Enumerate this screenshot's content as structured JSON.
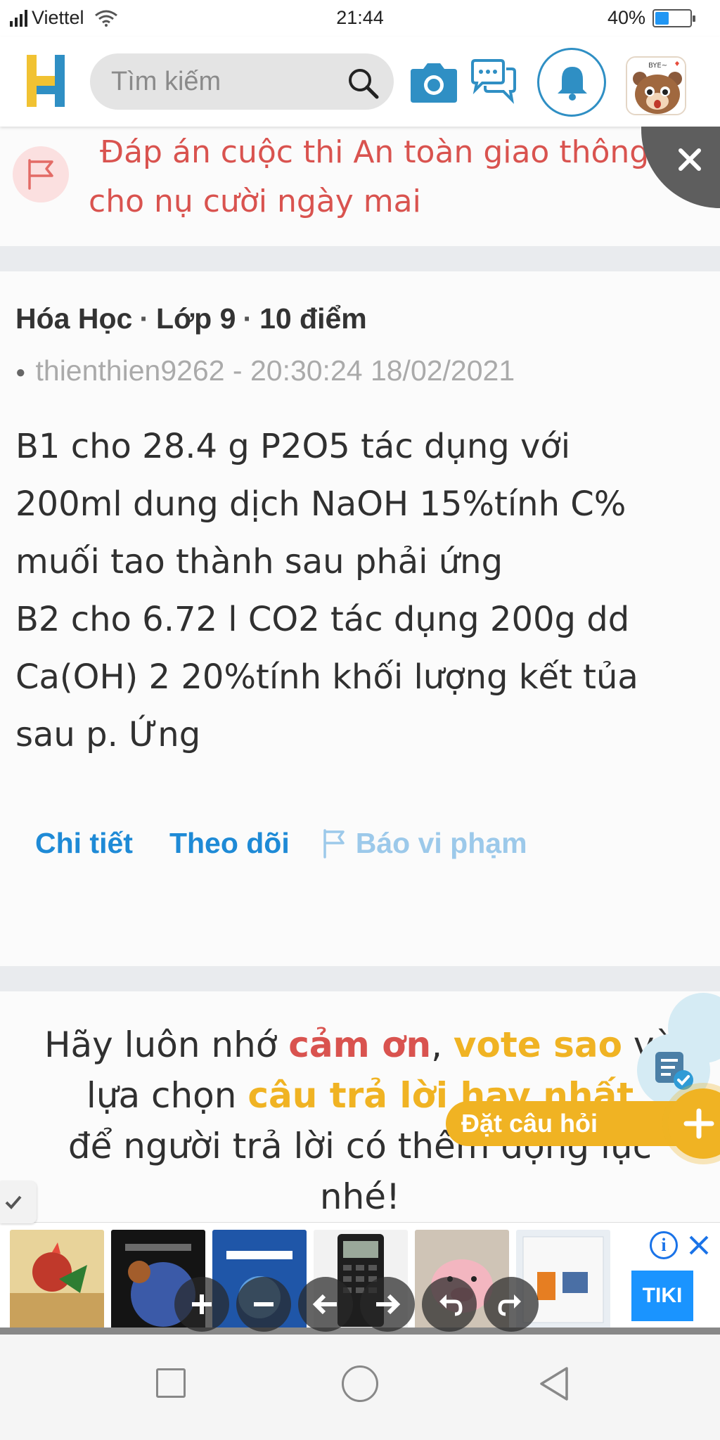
{
  "status_bar": {
    "carrier": "Viettel",
    "time": "21:44",
    "battery_percent": "40%",
    "battery_level": 0.4
  },
  "header": {
    "search_placeholder": "Tìm kiếm",
    "icons": [
      "logo-h-icon",
      "search-icon",
      "camera-icon",
      "chat-icon",
      "bell-icon",
      "avatar"
    ]
  },
  "announcement": {
    "text": "Đáp án cuộc thi An toàn giao thông cho nụ cười ngày mai"
  },
  "question": {
    "subject": "Hóa Học",
    "grade": "Lớp 9",
    "points": "10 điểm",
    "author_line": "thienthien9262 - 20:30:24 18/02/2021",
    "body_lines": [
      "B1 cho 28.4 g P2O5 tác dụng với",
      "200ml dung dịch NaOH 15%tính C%",
      "muối tao thành sau  phải ứng",
      "B2 cho  6.72 l CO2 tác dụng 200g dd",
      "Ca(OH) 2 20%tính khối lượng kết tủa",
      "sau p. Ứng"
    ],
    "actions": {
      "detail": "Chi tiết",
      "follow": "Theo dõi",
      "report": "Báo vi phạm"
    }
  },
  "reminder": {
    "part1": "Hãy luôn nhớ ",
    "thanks": "cảm ơn",
    "comma": ", ",
    "vote": "vote sao",
    "part2": " và",
    "part3": "lựa chọn ",
    "best": "câu trả lời hay nhất",
    "part4": "để người trả lời có thêm động lực",
    "part5": "nhé!"
  },
  "floating": {
    "ask_label": "Đặt câu hỏi"
  },
  "ad": {
    "brand": "TIKI",
    "info": "i"
  },
  "colors": {
    "primary_blue": "#1e8ad6",
    "accent_red": "#d9534f",
    "accent_yellow": "#f0b323",
    "background": "#fbfbfb"
  }
}
